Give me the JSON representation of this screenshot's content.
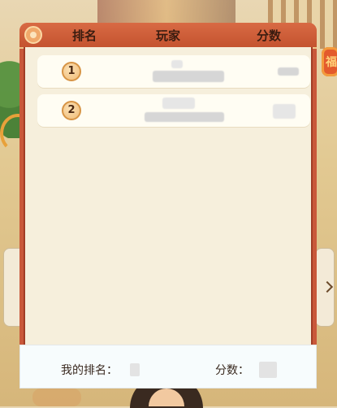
{
  "header": {
    "rank_label": "排名",
    "player_label": "玩家",
    "score_label": "分数"
  },
  "rows": [
    {
      "rank": "1"
    },
    {
      "rank": "2"
    }
  ],
  "footer": {
    "my_rank_label": "我的排名：",
    "score_label": "分数："
  },
  "background": {
    "lantern_char": "福"
  },
  "colors": {
    "panel": "#c9583a",
    "panel_inner": "#f6efdc",
    "badge": "#f0bc76",
    "footer": "#f7fcfd"
  }
}
